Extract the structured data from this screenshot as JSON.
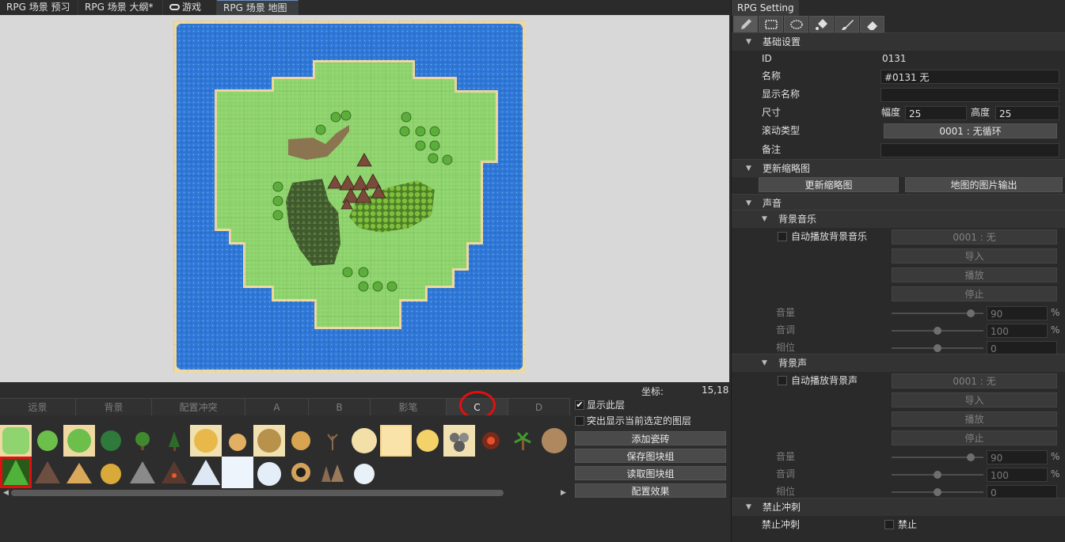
{
  "tabs": [
    {
      "label": "RPG 场景 预习",
      "active": false,
      "icon": ""
    },
    {
      "label": "RPG 场景 大纲*",
      "active": false,
      "icon": ""
    },
    {
      "label": "游戏",
      "active": false,
      "icon": "gamepad-icon"
    },
    {
      "label": "RPG 场景 地图",
      "active": true,
      "icon": ""
    }
  ],
  "status": {
    "coord_label": "坐标:",
    "coord_value": "15,18"
  },
  "layer_tabs": [
    {
      "label": "远景",
      "active": false
    },
    {
      "label": "背景",
      "active": false
    },
    {
      "label": "配置冲突",
      "active": false
    },
    {
      "label": "A",
      "active": false
    },
    {
      "label": "B",
      "active": false
    },
    {
      "label": "影笔",
      "active": false
    },
    {
      "label": "C",
      "active": true
    },
    {
      "label": "D",
      "active": false
    }
  ],
  "layer_options": {
    "show_layer": {
      "label": "显示此层",
      "checked": true
    },
    "highlight_layer": {
      "label": "突出显示当前选定的图层",
      "checked": false
    },
    "buttons": [
      "添加瓷砖",
      "保存图块组",
      "读取图块组",
      "配置效果"
    ]
  },
  "palette": {
    "selected_index": 18,
    "tiles": [
      "grass-light",
      "grass-bush",
      "grass-dark",
      "grass-shrub",
      "tree-round",
      "tree-pine",
      "sand-hex",
      "sand-rock",
      "sand-pit",
      "sand-burst",
      "dead-tree",
      "sand-round",
      "desert-light",
      "desert-round",
      "rock-pile",
      "lava-rock",
      "palm-tree",
      "brick-round",
      "forest-pine",
      "mountain-brown",
      "mountain-sand",
      "mountain-gold",
      "mountain-grey",
      "mountain-lava",
      "mountain-snow",
      "snow-flat",
      "snow-hill",
      "crater",
      "rock-spikes",
      "snow-mound"
    ]
  },
  "panel": {
    "title": "RPG Setting",
    "tools": [
      "pencil-icon",
      "rect-select-icon",
      "ellipse-icon",
      "fill-bucket-icon",
      "brush-icon",
      "eraser-icon"
    ],
    "basic": {
      "header": "基础设置",
      "id_label": "ID",
      "id_value": "0131",
      "name_label": "名称",
      "name_value": "#0131 无",
      "display_name_label": "显示名称",
      "display_name_value": "",
      "size_label": "尺寸",
      "width_label": "幅度",
      "width_value": "25",
      "height_label": "高度",
      "height_value": "25",
      "scroll_label": "滚动类型",
      "scroll_value": "0001 : 无循环",
      "note_label": "备注",
      "note_value": ""
    },
    "thumbnail": {
      "header": "更新缩略图",
      "update_btn": "更新缩略图",
      "export_btn": "地图的图片输出"
    },
    "sound": {
      "header": "声音",
      "bgm": {
        "header": "背景音乐",
        "auto_label": "自动播放背景音乐",
        "auto_checked": false,
        "track": "0001 : 无",
        "import": "导入",
        "play": "播放",
        "stop": "停止",
        "volume_label": "音量",
        "volume": "90",
        "volume_level": 0.9,
        "pitch_label": "音调",
        "pitch": "100",
        "pitch_level": 0.5,
        "phase_label": "相位",
        "phase": "0",
        "phase_level": 0.5,
        "percent": "%"
      },
      "bgs": {
        "header": "背景声",
        "auto_label": "自动播放背景声",
        "auto_checked": false,
        "track": "0001 : 无",
        "import": "导入",
        "play": "播放",
        "stop": "停止",
        "volume_label": "音量",
        "volume": "90",
        "volume_level": 0.9,
        "pitch_label": "音调",
        "pitch": "100",
        "pitch_level": 0.5,
        "phase_label": "相位",
        "phase": "0",
        "phase_level": 0.5,
        "percent": "%"
      }
    },
    "dash": {
      "header": "禁止冲刺",
      "label": "禁止冲刺",
      "checkbox_label": "禁止",
      "checked": false
    }
  },
  "colors": {
    "water": "#2f78d8",
    "grass": "#8fd46e",
    "sand": "#eed9a2",
    "accent_red": "#e01010"
  }
}
